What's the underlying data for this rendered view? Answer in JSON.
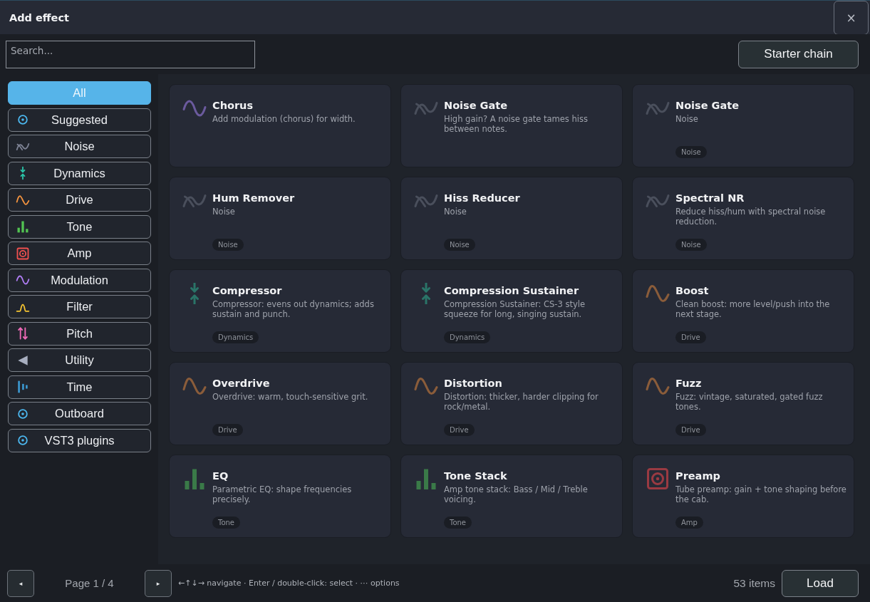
{
  "window": {
    "title": "Add effect",
    "close": "×"
  },
  "toolbar": {
    "search": {
      "placeholder": "Search..."
    },
    "starter_chain": "Starter chain"
  },
  "categories": [
    {
      "label": "All",
      "kind": "none",
      "selected": true
    },
    {
      "label": "Suggested",
      "kind": "target",
      "color": "#4cb8f0",
      "selected": false
    },
    {
      "label": "Noise",
      "kind": "noise",
      "color": "#7d8294",
      "selected": false
    },
    {
      "label": "Dynamics",
      "kind": "dynamics",
      "color": "#2ac4a8",
      "selected": false
    },
    {
      "label": "Drive",
      "kind": "drive",
      "color": "#f5943f",
      "selected": false
    },
    {
      "label": "Tone",
      "kind": "tone",
      "color": "#52c452",
      "selected": false
    },
    {
      "label": "Amp",
      "kind": "amp",
      "color": "#f0504f",
      "selected": false
    },
    {
      "label": "Modulation",
      "kind": "modulation",
      "color": "#b07df5",
      "selected": false
    },
    {
      "label": "Filter",
      "kind": "filter",
      "color": "#f5c431",
      "selected": false
    },
    {
      "label": "Pitch",
      "kind": "pitch",
      "color": "#f06ab8",
      "selected": false
    },
    {
      "label": "Utility",
      "kind": "utility",
      "color": "#a8afc0",
      "selected": false
    },
    {
      "label": "Time",
      "kind": "time",
      "color": "#3d9ed8",
      "selected": false
    },
    {
      "label": "Outboard",
      "kind": "target",
      "color": "#4cb8f0",
      "selected": false
    },
    {
      "label": "VST3 plugins",
      "kind": "target",
      "color": "#4cb8f0",
      "selected": false
    }
  ],
  "effects": [
    {
      "title": "Chorus",
      "description": "Add modulation (chorus) for width.",
      "kind": "modulation",
      "color": "#6b5a9e"
    },
    {
      "title": "Noise Gate",
      "description": "High gain? A noise gate tames hiss between notes.",
      "kind": "noise",
      "color": "#4a4f5c"
    },
    {
      "title": "Noise Gate",
      "description": "Noise",
      "kind": "noise",
      "color": "#4a4f5c",
      "tag": "Noise"
    },
    {
      "title": "Hum Remover",
      "description": "Noise",
      "kind": "noise",
      "color": "#4a4f5c",
      "tag": "Noise"
    },
    {
      "title": "Hiss Reducer",
      "description": "Noise",
      "kind": "noise",
      "color": "#4a4f5c",
      "tag": "Noise"
    },
    {
      "title": "Spectral NR",
      "description": "Reduce hiss/hum with spectral noise reduction.",
      "kind": "noise",
      "color": "#4a4f5c",
      "tag": "Noise"
    },
    {
      "title": "Compressor",
      "description": "Compressor: evens out dynamics; adds sustain and punch.",
      "kind": "dynamics",
      "color": "#2a7468",
      "tag": "Dynamics"
    },
    {
      "title": "Compression Sustainer",
      "description": "Compression Sustainer: CS-3 style squeeze for long, singing sustain.",
      "kind": "dynamics",
      "color": "#2a7468",
      "tag": "Dynamics"
    },
    {
      "title": "Boost",
      "description": "Clean boost: more level/push into the next stage.",
      "kind": "drive",
      "color": "#8a5c3a",
      "tag": "Drive"
    },
    {
      "title": "Overdrive",
      "description": "Overdrive: warm, touch-sensitive grit.",
      "kind": "drive",
      "color": "#8a5c3a",
      "tag": "Drive"
    },
    {
      "title": "Distortion",
      "description": "Distortion: thicker, harder clipping for rock/metal.",
      "kind": "drive",
      "color": "#8a5c3a",
      "tag": "Drive"
    },
    {
      "title": "Fuzz",
      "description": "Fuzz: vintage, saturated, gated fuzz tones.",
      "kind": "drive",
      "color": "#8a5c3a",
      "tag": "Drive"
    },
    {
      "title": "EQ",
      "description": "Parametric EQ: shape frequencies precisely.",
      "kind": "tone",
      "color": "#3a7a48",
      "tag": "Tone"
    },
    {
      "title": "Tone Stack",
      "description": "Amp tone stack: Bass / Mid / Treble voicing.",
      "kind": "tone",
      "color": "#3a7a48",
      "tag": "Tone"
    },
    {
      "title": "Preamp",
      "description": "Tube preamp: gain + tone shaping before the cab.",
      "kind": "amp",
      "color": "#9a3a42",
      "tag": "Amp"
    }
  ],
  "footer": {
    "prev": "◂",
    "page": "Page 1 / 4",
    "next": "▸",
    "hint": "←↑↓→ navigate · Enter / double-click: select · ⋯ options",
    "count": "53 items",
    "load": "Load"
  }
}
